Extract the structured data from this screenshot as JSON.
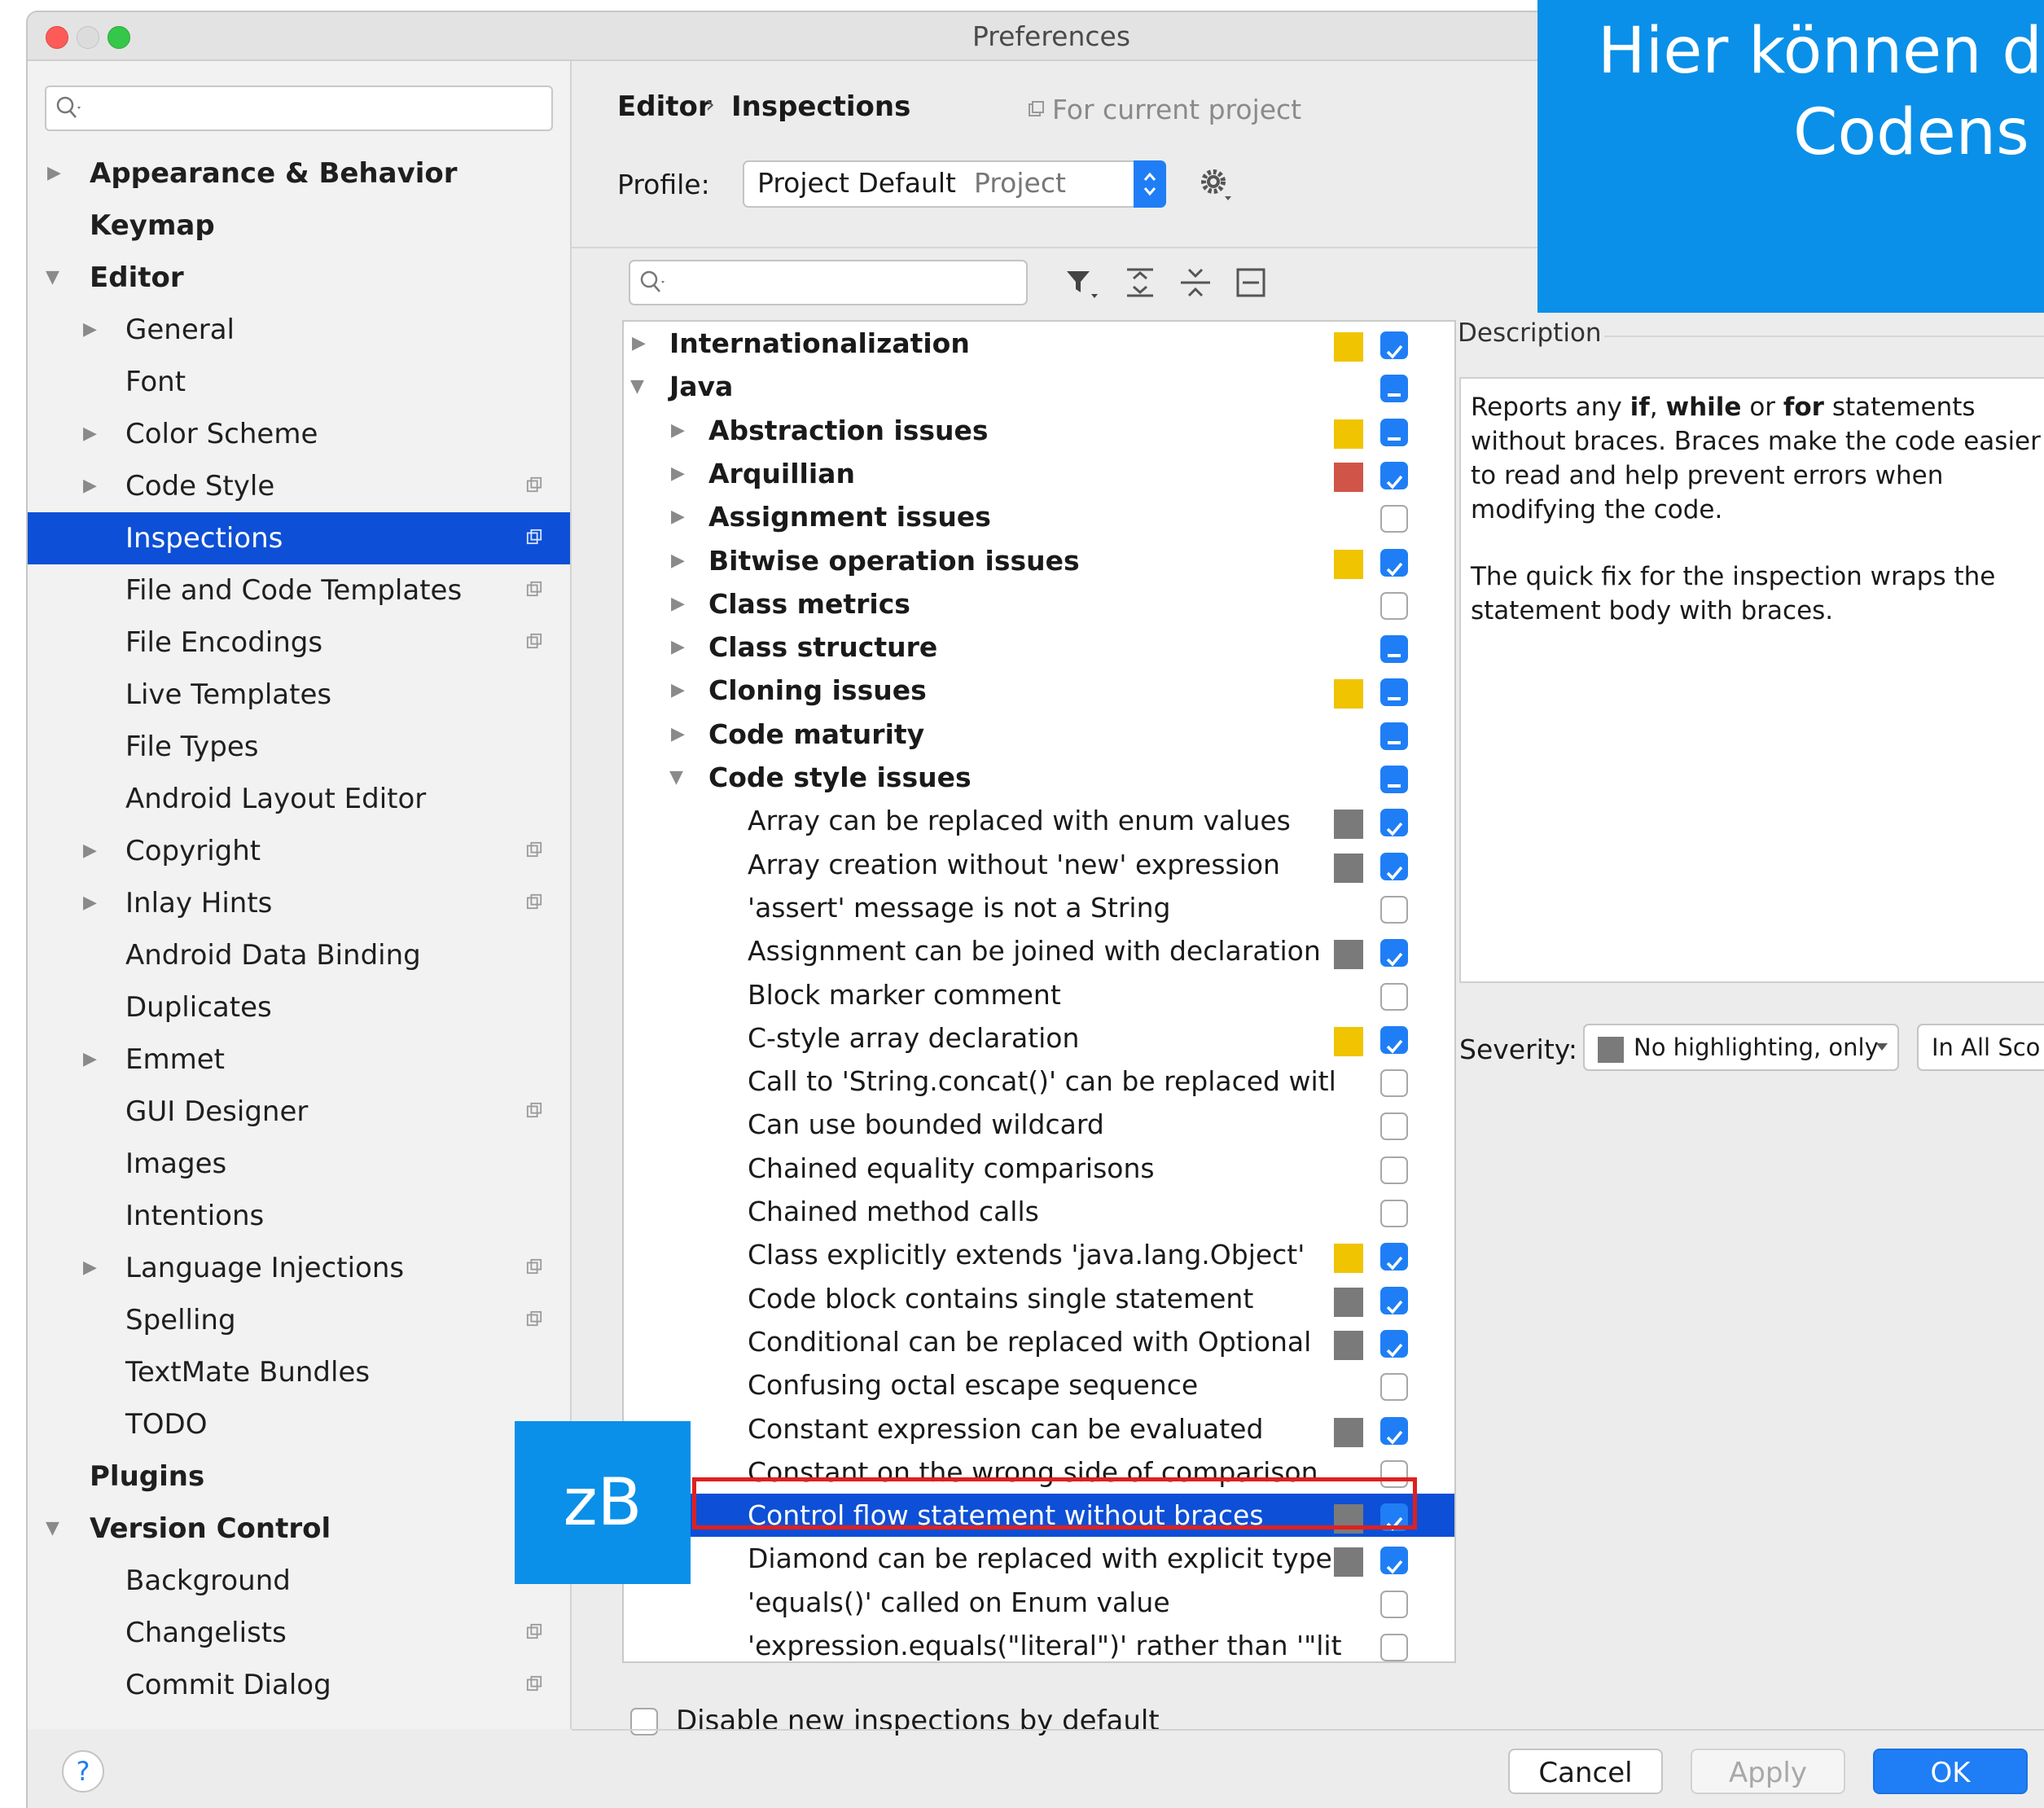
{
  "window": {
    "title": "Preferences"
  },
  "sidebar": {
    "search_placeholder": "",
    "items": [
      {
        "label": "Appearance & Behavior",
        "level": 0,
        "bold": true,
        "arrow": "right",
        "project": false
      },
      {
        "label": "Keymap",
        "level": 0,
        "bold": true,
        "arrow": "",
        "project": false
      },
      {
        "label": "Editor",
        "level": 0,
        "bold": true,
        "arrow": "down",
        "project": false
      },
      {
        "label": "General",
        "level": 1,
        "bold": false,
        "arrow": "right",
        "project": false
      },
      {
        "label": "Font",
        "level": 1,
        "bold": false,
        "arrow": "",
        "project": false
      },
      {
        "label": "Color Scheme",
        "level": 1,
        "bold": false,
        "arrow": "right",
        "project": false
      },
      {
        "label": "Code Style",
        "level": 1,
        "bold": false,
        "arrow": "right",
        "project": true
      },
      {
        "label": "Inspections",
        "level": 1,
        "bold": false,
        "arrow": "",
        "project": true,
        "selected": true
      },
      {
        "label": "File and Code Templates",
        "level": 1,
        "bold": false,
        "arrow": "",
        "project": true
      },
      {
        "label": "File Encodings",
        "level": 1,
        "bold": false,
        "arrow": "",
        "project": true
      },
      {
        "label": "Live Templates",
        "level": 1,
        "bold": false,
        "arrow": "",
        "project": false
      },
      {
        "label": "File Types",
        "level": 1,
        "bold": false,
        "arrow": "",
        "project": false
      },
      {
        "label": "Android Layout Editor",
        "level": 1,
        "bold": false,
        "arrow": "",
        "project": false
      },
      {
        "label": "Copyright",
        "level": 1,
        "bold": false,
        "arrow": "right",
        "project": true
      },
      {
        "label": "Inlay Hints",
        "level": 1,
        "bold": false,
        "arrow": "right",
        "project": true
      },
      {
        "label": "Android Data Binding",
        "level": 1,
        "bold": false,
        "arrow": "",
        "project": false
      },
      {
        "label": "Duplicates",
        "level": 1,
        "bold": false,
        "arrow": "",
        "project": false
      },
      {
        "label": "Emmet",
        "level": 1,
        "bold": false,
        "arrow": "right",
        "project": false
      },
      {
        "label": "GUI Designer",
        "level": 1,
        "bold": false,
        "arrow": "",
        "project": true
      },
      {
        "label": "Images",
        "level": 1,
        "bold": false,
        "arrow": "",
        "project": false
      },
      {
        "label": "Intentions",
        "level": 1,
        "bold": false,
        "arrow": "",
        "project": false
      },
      {
        "label": "Language Injections",
        "level": 1,
        "bold": false,
        "arrow": "right",
        "project": true
      },
      {
        "label": "Spelling",
        "level": 1,
        "bold": false,
        "arrow": "",
        "project": true
      },
      {
        "label": "TextMate Bundles",
        "level": 1,
        "bold": false,
        "arrow": "",
        "project": false
      },
      {
        "label": "TODO",
        "level": 1,
        "bold": false,
        "arrow": "",
        "project": false
      },
      {
        "label": "Plugins",
        "level": 0,
        "bold": true,
        "arrow": "",
        "project": false
      },
      {
        "label": "Version Control",
        "level": 0,
        "bold": true,
        "arrow": "down",
        "project": false
      },
      {
        "label": "Background",
        "level": 1,
        "bold": false,
        "arrow": "",
        "project": false
      },
      {
        "label": "Changelists",
        "level": 1,
        "bold": false,
        "arrow": "",
        "project": true
      },
      {
        "label": "Commit Dialog",
        "level": 1,
        "bold": false,
        "arrow": "",
        "project": true
      }
    ]
  },
  "breadcrumb": {
    "parent": "Editor",
    "separator": "›",
    "current": "Inspections",
    "scope_note": "For current project"
  },
  "profile": {
    "label": "Profile:",
    "value": "Project Default",
    "type": "Project"
  },
  "filter": {
    "placeholder": ""
  },
  "inspections": [
    {
      "label": "Internationalization",
      "level": 0,
      "bold": true,
      "arrow": "right",
      "sev": "#f0c400",
      "cb": "checked"
    },
    {
      "label": "Java",
      "level": 0,
      "bold": true,
      "arrow": "down",
      "sev": "",
      "cb": "partial"
    },
    {
      "label": "Abstraction issues",
      "level": 1,
      "bold": true,
      "arrow": "right",
      "sev": "#f0c400",
      "cb": "partial"
    },
    {
      "label": "Arquillian",
      "level": 1,
      "bold": true,
      "arrow": "right",
      "sev": "#d05548",
      "cb": "checked"
    },
    {
      "label": "Assignment issues",
      "level": 1,
      "bold": true,
      "arrow": "right",
      "sev": "",
      "cb": "empty"
    },
    {
      "label": "Bitwise operation issues",
      "level": 1,
      "bold": true,
      "arrow": "right",
      "sev": "#f0c400",
      "cb": "checked"
    },
    {
      "label": "Class metrics",
      "level": 1,
      "bold": true,
      "arrow": "right",
      "sev": "",
      "cb": "empty"
    },
    {
      "label": "Class structure",
      "level": 1,
      "bold": true,
      "arrow": "right",
      "sev": "",
      "cb": "partial"
    },
    {
      "label": "Cloning issues",
      "level": 1,
      "bold": true,
      "arrow": "right",
      "sev": "#f0c400",
      "cb": "partial"
    },
    {
      "label": "Code maturity",
      "level": 1,
      "bold": true,
      "arrow": "right",
      "sev": "",
      "cb": "partial"
    },
    {
      "label": "Code style issues",
      "level": 1,
      "bold": true,
      "arrow": "down",
      "sev": "",
      "cb": "partial"
    },
    {
      "label": "Array can be replaced with enum values",
      "level": 2,
      "bold": false,
      "arrow": "",
      "sev": "#7a7a7a",
      "cb": "checked"
    },
    {
      "label": "Array creation without 'new' expression",
      "level": 2,
      "bold": false,
      "arrow": "",
      "sev": "#7a7a7a",
      "cb": "checked"
    },
    {
      "label": "'assert' message is not a String",
      "level": 2,
      "bold": false,
      "arrow": "",
      "sev": "",
      "cb": "empty"
    },
    {
      "label": "Assignment can be joined with declaration",
      "level": 2,
      "bold": false,
      "arrow": "",
      "sev": "#7a7a7a",
      "cb": "checked"
    },
    {
      "label": "Block marker comment",
      "level": 2,
      "bold": false,
      "arrow": "",
      "sev": "",
      "cb": "empty"
    },
    {
      "label": "C-style array declaration",
      "level": 2,
      "bold": false,
      "arrow": "",
      "sev": "#f0c400",
      "cb": "checked"
    },
    {
      "label": "Call to 'String.concat()' can be replaced witl",
      "level": 2,
      "bold": false,
      "arrow": "",
      "sev": "",
      "cb": "empty"
    },
    {
      "label": "Can use bounded wildcard",
      "level": 2,
      "bold": false,
      "arrow": "",
      "sev": "",
      "cb": "empty"
    },
    {
      "label": "Chained equality comparisons",
      "level": 2,
      "bold": false,
      "arrow": "",
      "sev": "",
      "cb": "empty"
    },
    {
      "label": "Chained method calls",
      "level": 2,
      "bold": false,
      "arrow": "",
      "sev": "",
      "cb": "empty"
    },
    {
      "label": "Class explicitly extends 'java.lang.Object'",
      "level": 2,
      "bold": false,
      "arrow": "",
      "sev": "#f0c400",
      "cb": "checked"
    },
    {
      "label": "Code block contains single statement",
      "level": 2,
      "bold": false,
      "arrow": "",
      "sev": "#7a7a7a",
      "cb": "checked"
    },
    {
      "label": "Conditional can be replaced with Optional",
      "level": 2,
      "bold": false,
      "arrow": "",
      "sev": "#7a7a7a",
      "cb": "checked"
    },
    {
      "label": "Confusing octal escape sequence",
      "level": 2,
      "bold": false,
      "arrow": "",
      "sev": "",
      "cb": "empty"
    },
    {
      "label": "Constant expression can be evaluated",
      "level": 2,
      "bold": false,
      "arrow": "",
      "sev": "#7a7a7a",
      "cb": "checked"
    },
    {
      "label": "Constant on the wrong side of comparison",
      "level": 2,
      "bold": false,
      "arrow": "",
      "sev": "",
      "cb": "empty"
    },
    {
      "label": "Control flow statement without braces",
      "level": 2,
      "bold": false,
      "arrow": "",
      "sev": "#7a7a7a",
      "cb": "checked",
      "selected": true
    },
    {
      "label": "Diamond can be replaced with explicit type",
      "level": 2,
      "bold": false,
      "arrow": "",
      "sev": "#7a7a7a",
      "cb": "checked"
    },
    {
      "label": "'equals()' called on Enum value",
      "level": 2,
      "bold": false,
      "arrow": "",
      "sev": "",
      "cb": "empty"
    },
    {
      "label": "'expression.equals(\"literal\")' rather than '\"lit",
      "level": 2,
      "bold": false,
      "arrow": "",
      "sev": "",
      "cb": "empty"
    }
  ],
  "disable_new": {
    "label": "Disable new inspections by default"
  },
  "description": {
    "title": "Description",
    "p1_a": "Reports any ",
    "p1_if": "if",
    "p1_b": ", ",
    "p1_while": "while",
    "p1_c": " or ",
    "p1_for": "for",
    "p1_d": " statements without braces. Braces make the code easier to read and help prevent errors when modifying the code.",
    "p2": "The quick fix for the inspection wraps the statement body with braces."
  },
  "severity": {
    "label": "Severity:",
    "value": "No highlighting, only",
    "scope": "In All Scopes",
    "scope_shown": "In All Sco"
  },
  "buttons": {
    "help": "?",
    "cancel": "Cancel",
    "apply": "Apply",
    "ok": "OK"
  },
  "annotations": {
    "callout_line1": "Hier können d",
    "callout_line2": "Codens",
    "tag": "zB"
  },
  "colors": {
    "selection": "#0d4fd6",
    "checkbox": "#1f7ef5",
    "callout": "#0a90e8",
    "highlight_box": "#e0201e"
  }
}
